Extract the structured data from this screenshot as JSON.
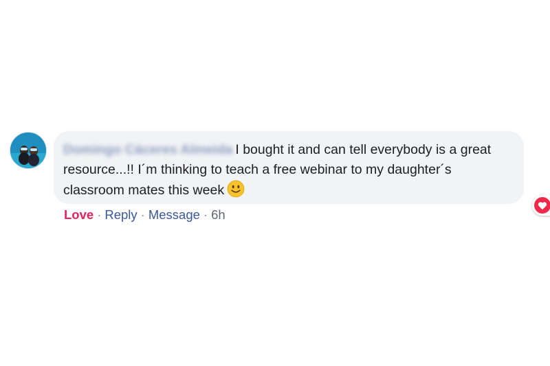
{
  "comment": {
    "author": "Domingo Cáceres Almeida",
    "text": "I bought it and can tell everybody is a great resource...!! I´m thinking to teach a free webinar to my daughter´s classroom mates this week",
    "emoji": "slightly-smiling-face-icon",
    "reaction_count": "1",
    "reaction_icon": "love-heart-icon",
    "colors": {
      "love": "#e0245e",
      "link": "#385898",
      "bubble": "#f2f3f5"
    }
  },
  "actions": {
    "love": "Love",
    "reply": "Reply",
    "message": "Message",
    "separator": "·",
    "time": "6h"
  }
}
